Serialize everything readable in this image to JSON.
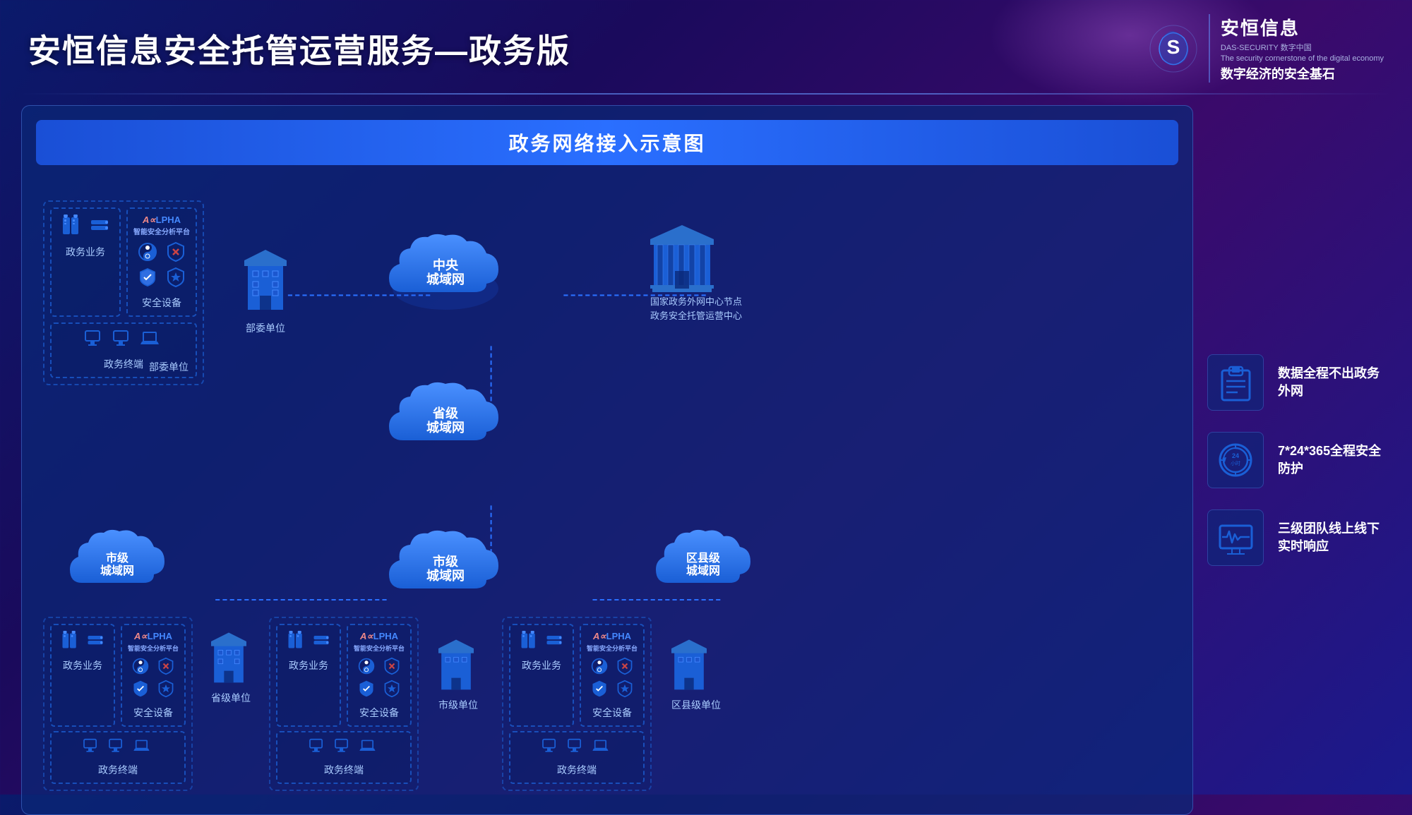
{
  "header": {
    "title": "安恒信息安全托管运营服务—政务版",
    "logo_company": "安恒信息",
    "logo_sub1": "DAS-SECURITY 数字中国",
    "logo_sub2": "The security cornerstone of the digital economy",
    "logo_slogan": "数字经济的安全基石"
  },
  "diagram": {
    "title": "政务网络接入示意图",
    "nodes": {
      "central_cloud": "中央\n城域网",
      "province_cloud": "省级\n城域网",
      "city_cloud_center": "市级\n城域网",
      "city_cloud_left": "市级\n城域网",
      "district_cloud": "区县级\n城域网"
    },
    "units": {
      "ministry": "部委单位",
      "national_center_line1": "国家政务外网中心节点",
      "national_center_line2": "政务安全托管运营中心",
      "province_unit": "省级单位",
      "city_unit": "市级单位",
      "district_unit": "区县级单位"
    },
    "boxes": {
      "alpha": "ALPHA\n智能安全分析平台",
      "gov_business": "政务业务",
      "gov_terminal": "政务终端",
      "security_equipment": "安全设备"
    }
  },
  "legend": {
    "items": [
      {
        "id": "data-security",
        "text": "数据全程不出政务外网",
        "icon": "clipboard"
      },
      {
        "id": "fulltime-protection",
        "text": "7*24*365全程安全防护",
        "icon": "clock"
      },
      {
        "id": "team-response",
        "text": "三级团队线上线下实时响应",
        "icon": "monitor"
      }
    ]
  }
}
